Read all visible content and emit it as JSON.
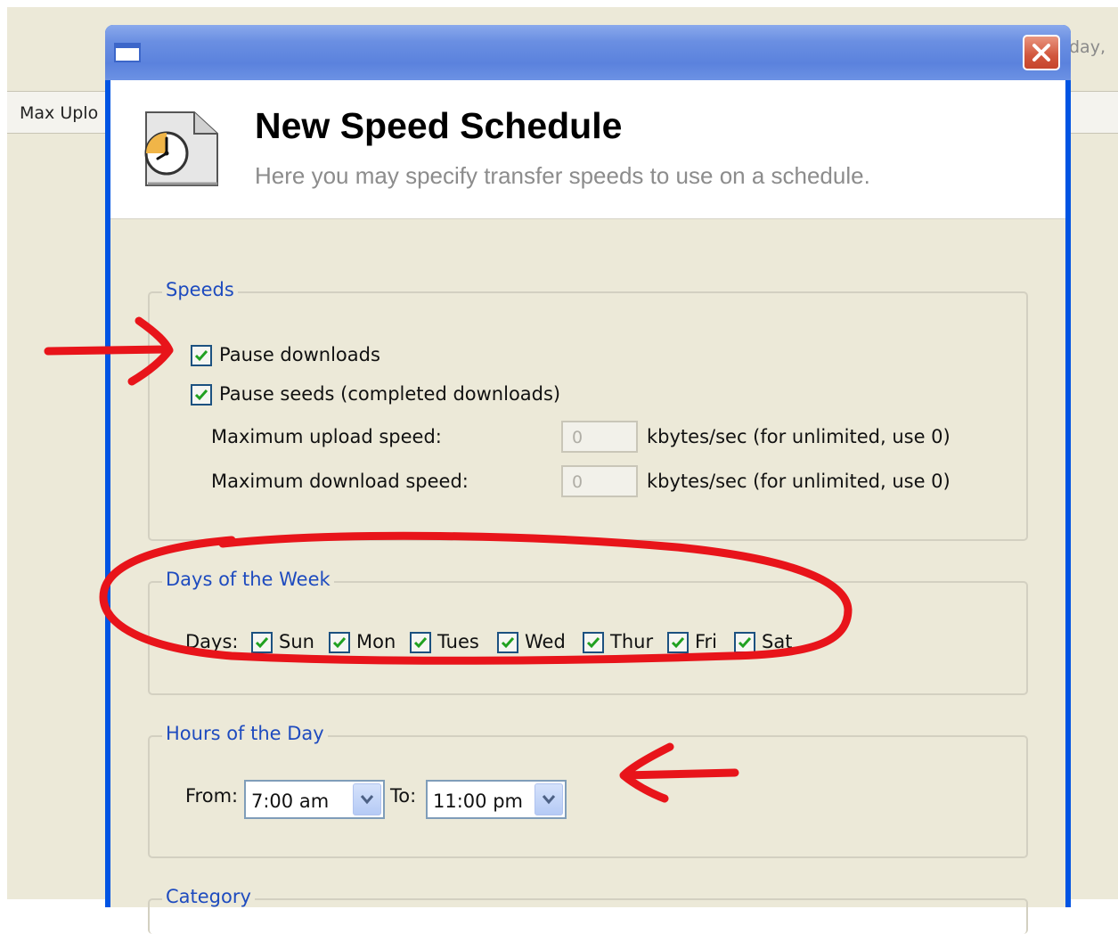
{
  "background": {
    "column_label": "Max Uplo",
    "day_fragment": "day,"
  },
  "dialog": {
    "title": "New Speed Schedule",
    "subtitle": "Here you may specify transfer speeds to use on a schedule.",
    "icon": "clock-document-icon"
  },
  "speeds": {
    "legend": "Speeds",
    "pause_downloads": {
      "label": "Pause downloads",
      "checked": true
    },
    "pause_seeds": {
      "label": "Pause seeds (completed downloads)",
      "checked": true
    },
    "upload": {
      "label": "Maximum upload speed:",
      "value": "0",
      "unit": "kbytes/sec (for unlimited, use 0)"
    },
    "download": {
      "label": "Maximum download speed:",
      "value": "0",
      "unit": "kbytes/sec (for unlimited, use 0)"
    }
  },
  "days": {
    "legend": "Days of the Week",
    "label": "Days:",
    "items": [
      {
        "label": "Sun",
        "checked": true
      },
      {
        "label": "Mon",
        "checked": true
      },
      {
        "label": "Tues",
        "checked": true
      },
      {
        "label": "Wed",
        "checked": true
      },
      {
        "label": "Thur",
        "checked": true
      },
      {
        "label": "Fri",
        "checked": true
      },
      {
        "label": "Sat",
        "checked": true
      }
    ]
  },
  "hours": {
    "legend": "Hours of the Day",
    "from_label": "From:",
    "from_value": "7:00 am",
    "to_label": "To:",
    "to_value": "11:00 pm"
  },
  "category": {
    "legend": "Category"
  },
  "colors": {
    "annotation": "#e8141a",
    "legend_text": "#1e4bbf",
    "checkmark": "#21a121",
    "titlebar": "#0054e3"
  }
}
